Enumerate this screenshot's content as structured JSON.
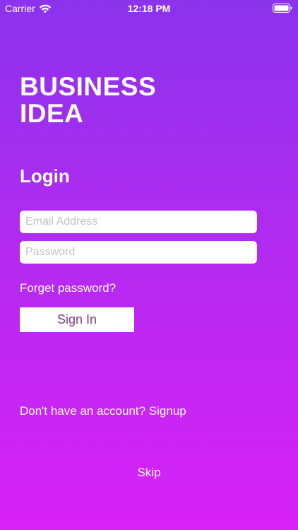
{
  "status_bar": {
    "carrier": "Carrier",
    "time": "12:18 PM",
    "wifi_icon": "wifi-icon",
    "battery_icon": "battery-icon"
  },
  "brand": {
    "line1": "BUSINESS",
    "line2": "IDEA"
  },
  "login": {
    "heading": "Login",
    "email_placeholder": "Email Address",
    "email_value": "",
    "password_placeholder": "Password",
    "password_value": "",
    "forget_label": "Forget password?",
    "signin_label": "Sign In",
    "signup_label": "Don't have an account? Signup",
    "skip_label": "Skip"
  },
  "colors": {
    "gradient_top": "#8b33ec",
    "gradient_bottom": "#d822f7",
    "button_text": "#7b3a85",
    "placeholder": "#c2c2c8"
  }
}
